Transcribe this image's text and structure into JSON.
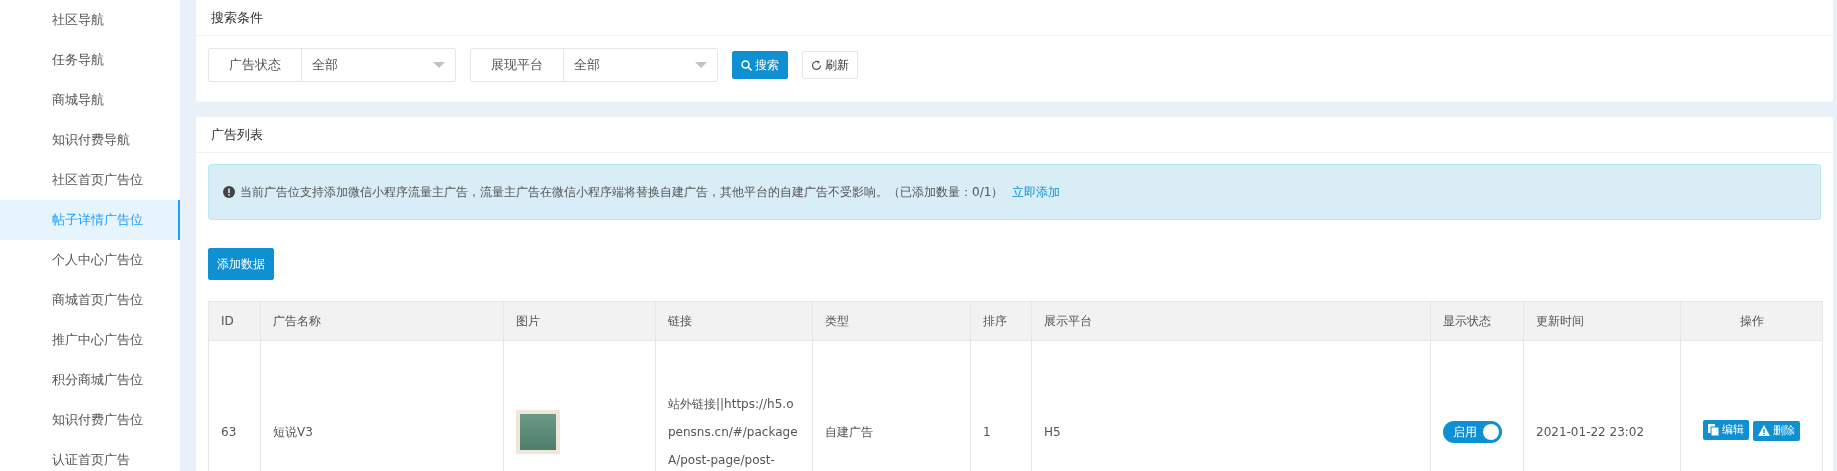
{
  "sidebar": {
    "items": [
      {
        "label": "社区导航",
        "selected": false
      },
      {
        "label": "任务导航",
        "selected": false
      },
      {
        "label": "商城导航",
        "selected": false
      },
      {
        "label": "知识付费导航",
        "selected": false
      },
      {
        "label": "社区首页广告位",
        "selected": false
      },
      {
        "label": "帖子详情广告位",
        "selected": true
      },
      {
        "label": "个人中心广告位",
        "selected": false
      },
      {
        "label": "商城首页广告位",
        "selected": false
      },
      {
        "label": "推广中心广告位",
        "selected": false
      },
      {
        "label": "积分商城广告位",
        "selected": false
      },
      {
        "label": "知识付费广告位",
        "selected": false
      },
      {
        "label": "认证首页广告",
        "selected": false
      }
    ]
  },
  "search_panel": {
    "title": "搜索条件",
    "filters": [
      {
        "label": "广告状态",
        "value": "全部"
      },
      {
        "label": "展现平台",
        "value": "全部"
      }
    ],
    "search_button": "搜索",
    "refresh_button": "刷新"
  },
  "list_panel": {
    "title": "广告列表",
    "notice": {
      "text": "当前广告位支持添加微信小程序流量主广告，流量主广告在微信小程序端将替换自建广告，其他平台的自建广告不受影响。（已添加数量：0/1）",
      "link": "立即添加"
    },
    "add_button": "添加数据",
    "table": {
      "columns": [
        "ID",
        "广告名称",
        "图片",
        "链接",
        "类型",
        "排序",
        "展示平台",
        "显示状态",
        "更新时间",
        "操作"
      ],
      "rows": [
        {
          "id": "63",
          "name": "短说V3",
          "link": "站外链接||https://h5.opensns.cn/#/packageA/post-page/post-",
          "type": "自建广告",
          "sort": "1",
          "platform": "H5",
          "status": {
            "label": "启用",
            "on": true
          },
          "updated": "2021-01-22 23:02",
          "actions": [
            "编辑",
            "删除"
          ]
        }
      ]
    }
  }
}
